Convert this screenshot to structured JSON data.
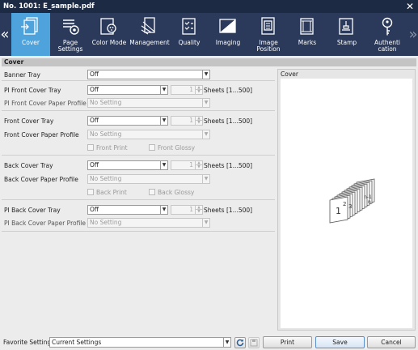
{
  "window": {
    "title": "No. 1001: E_sample.pdf",
    "close_icon": "close-icon"
  },
  "toolbar": {
    "prev_icon": "chevron-left-icon",
    "next_icon": "chevron-right-icon",
    "items": [
      {
        "label": "Cover",
        "icon": "cover-icon",
        "active": true
      },
      {
        "label": "Page\nSettings",
        "icon": "page-settings-icon",
        "active": false
      },
      {
        "label": "Color Mode",
        "icon": "color-mode-icon",
        "active": false
      },
      {
        "label": "Management",
        "icon": "management-icon",
        "active": false
      },
      {
        "label": "Quality",
        "icon": "quality-icon",
        "active": false
      },
      {
        "label": "Imaging",
        "icon": "imaging-icon",
        "active": false
      },
      {
        "label": "Image\nPosition",
        "icon": "image-position-icon",
        "active": false
      },
      {
        "label": "Marks",
        "icon": "marks-icon",
        "active": false
      },
      {
        "label": "Stamp",
        "icon": "stamp-icon",
        "active": false
      },
      {
        "label": "Authenti\ncation",
        "icon": "authentication-icon",
        "active": false
      }
    ]
  },
  "section": {
    "title": "Cover"
  },
  "banner": {
    "label": "Banner Tray",
    "value": "Off"
  },
  "pi_front": {
    "tray_label": "PI Front Cover Tray",
    "tray_value": "Off",
    "sheets_value": "1",
    "sheets_unit": "Sheets [1...500]",
    "profile_label": "PI Front Cover Paper Profile",
    "profile_value": "No Setting"
  },
  "front": {
    "tray_label": "Front Cover Tray",
    "tray_value": "Off",
    "sheets_value": "1",
    "sheets_unit": "Sheets [1...500]",
    "profile_label": "Front Cover Paper Profile",
    "profile_value": "No Setting",
    "check_print": "Front Print",
    "check_glossy": "Front Glossy"
  },
  "back": {
    "tray_label": "Back Cover Tray",
    "tray_value": "Off",
    "sheets_value": "1",
    "sheets_unit": "Sheets [1...500]",
    "profile_label": "Back Cover Paper Profile",
    "profile_value": "No Setting",
    "check_print": "Back Print",
    "check_glossy": "Back Glossy"
  },
  "pi_back": {
    "tray_label": "PI Back Cover Tray",
    "tray_value": "Off",
    "sheets_value": "1",
    "sheets_unit": "Sheets [1...500]",
    "profile_label": "PI Back Cover Paper Profile",
    "profile_value": "No Setting"
  },
  "preview": {
    "title": "Cover",
    "page_labels": [
      "1",
      "2",
      "3",
      "n-1",
      "n"
    ]
  },
  "footer": {
    "favorite_label": "Favorite Setting",
    "favorite_value": "Current Settings",
    "refresh_icon": "refresh-icon",
    "save_icon": "save-disk-icon",
    "print_label": "Print",
    "save_label": "Save",
    "cancel_label": "Cancel"
  },
  "colors": {
    "titlebar": "#1d2a44",
    "toolbar": "#2b3a5b",
    "active_tab": "#4fa3dd",
    "save_border": "#5c8fc7"
  }
}
